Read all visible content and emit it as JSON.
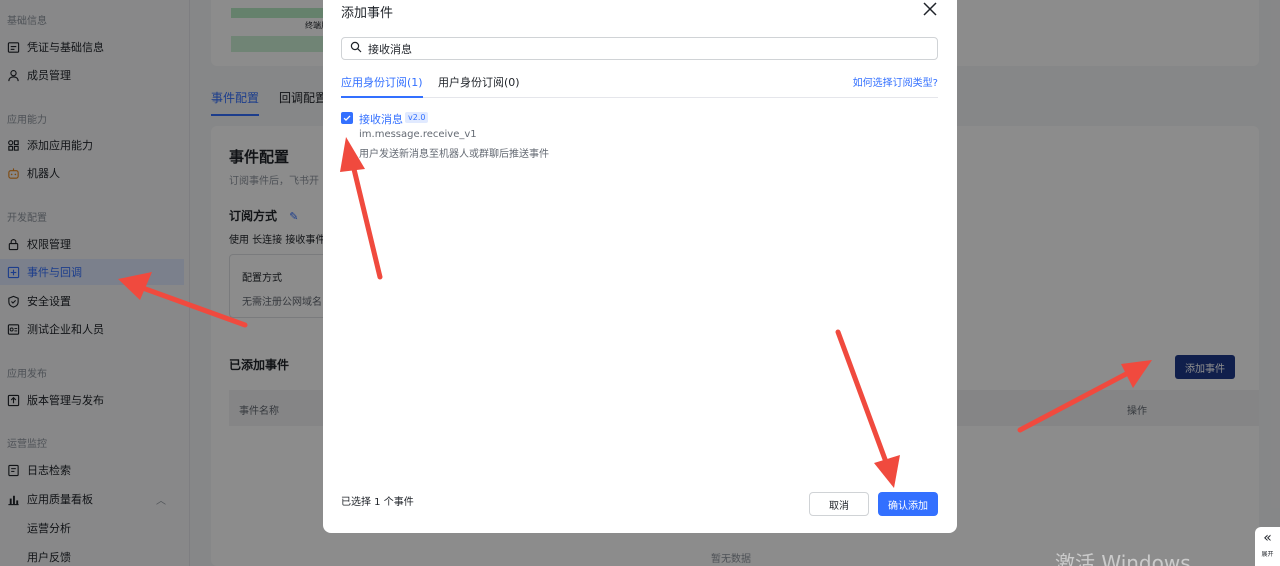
{
  "sidebar": {
    "sections": [
      {
        "label": "基础信息"
      },
      {
        "label": "应用能力"
      },
      {
        "label": "开发配置"
      },
      {
        "label": "应用发布"
      },
      {
        "label": "运营监控"
      }
    ],
    "items": [
      {
        "label": "凭证与基础信息",
        "icon": "credentials-icon"
      },
      {
        "label": "成员管理",
        "icon": "user-icon"
      },
      {
        "label": "添加应用能力",
        "icon": "grid-icon"
      },
      {
        "label": "机器人",
        "icon": "bot-icon"
      },
      {
        "label": "权限管理",
        "icon": "lock-icon"
      },
      {
        "label": "事件与回调",
        "icon": "event-icon"
      },
      {
        "label": "安全设置",
        "icon": "shield-icon"
      },
      {
        "label": "测试企业和人员",
        "icon": "test-icon"
      },
      {
        "label": "版本管理与发布",
        "icon": "release-icon"
      },
      {
        "label": "日志检索",
        "icon": "log-icon"
      },
      {
        "label": "应用质量看板",
        "icon": "chart-icon"
      }
    ],
    "subitems": [
      {
        "label": "运营分析"
      },
      {
        "label": "用户反馈"
      }
    ]
  },
  "main": {
    "stat_label": "终端用户",
    "tabs": [
      {
        "label": "事件配置"
      },
      {
        "label": "回调配置"
      }
    ],
    "panel_title": "事件配置",
    "panel_desc": "订阅事件后，飞书开",
    "subscribe_title": "订阅方式",
    "subscribe_desc": "使用 长连接 接收事件",
    "config_title": "配置方式",
    "config_desc": "无需注册公网域名",
    "added_title": "已添加事件",
    "add_button": "添加事件",
    "col_name": "事件名称",
    "col_op": "操作",
    "no_data": "暂无数据"
  },
  "modal": {
    "title": "添加事件",
    "search_value": "接收消息",
    "tabs": [
      {
        "label": "应用身份订阅(1)"
      },
      {
        "label": "用户身份订阅(0)"
      }
    ],
    "help_link": "如何选择订阅类型?",
    "event": {
      "name": "接收消息",
      "version": "v2.0",
      "key": "im.message.receive_v1",
      "desc": "用户发送新消息至机器人或群聊后推送事件",
      "checked": true
    },
    "selected_count": "已选择 1 个事件",
    "cancel": "取消",
    "confirm": "确认添加"
  },
  "watermark": "激活 Windows",
  "corner": {
    "chevron": "«",
    "label": "展开"
  },
  "colors": {
    "accent": "#3370ff",
    "arrow": "#f04a3e",
    "dark_button": "#1e3a8a"
  }
}
